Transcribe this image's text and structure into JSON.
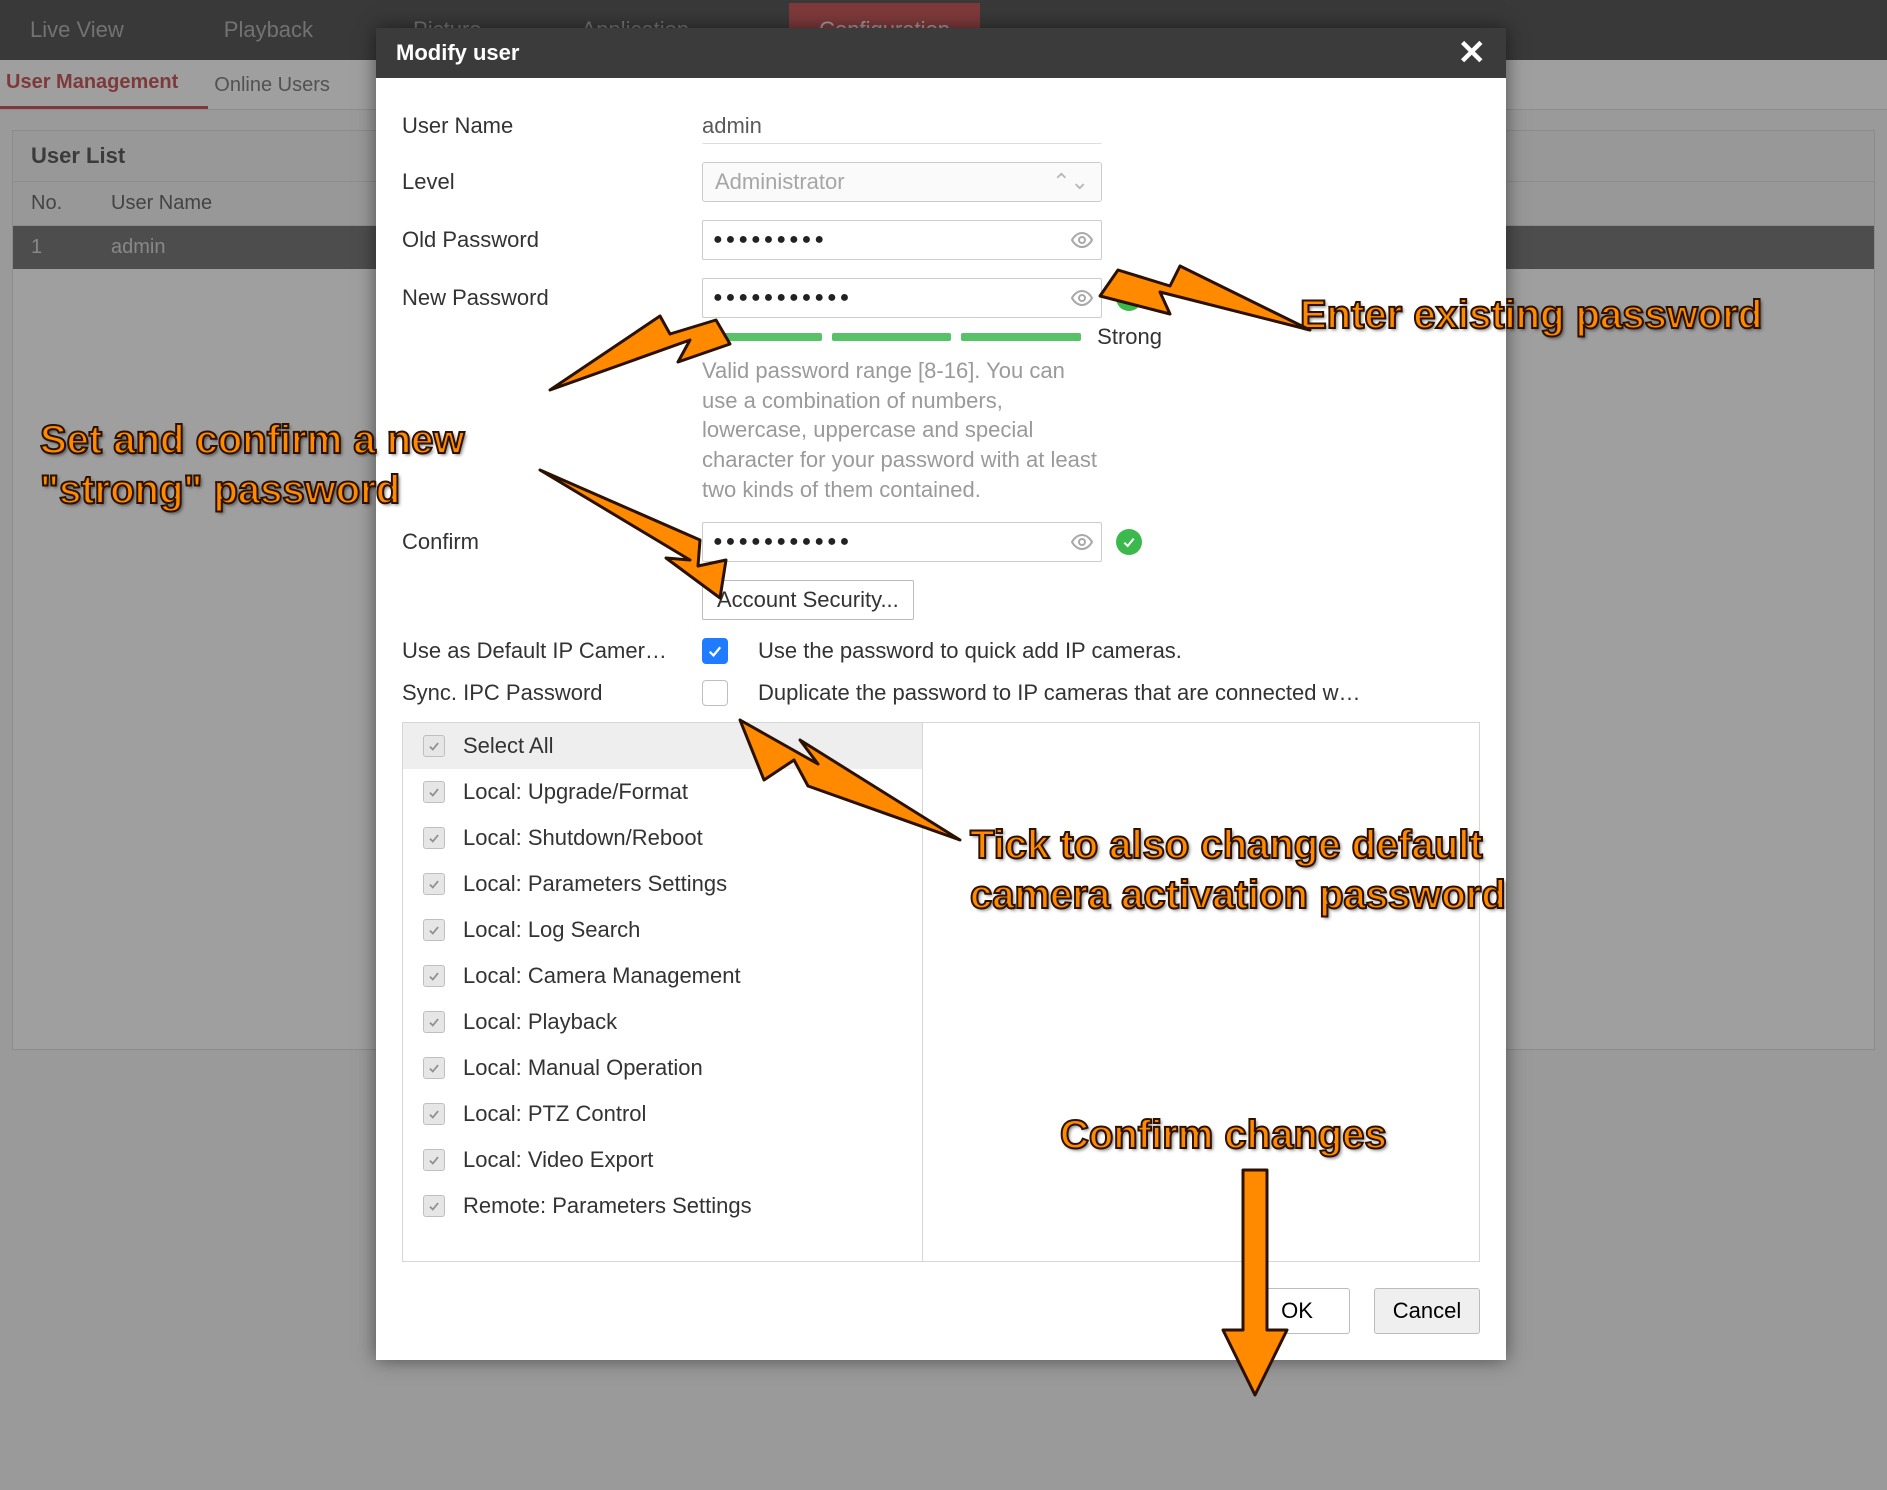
{
  "topnav": {
    "items": [
      "Live View",
      "Playback",
      "Picture",
      "Application",
      "Configuration"
    ],
    "active_index": 4
  },
  "subtabs": {
    "items": [
      "User Management",
      "Online Users"
    ],
    "active_index": 0
  },
  "userlist": {
    "title": "User List",
    "col_no": "No.",
    "col_user": "User Name",
    "rows": [
      {
        "no": "1",
        "user": "admin"
      }
    ]
  },
  "modal": {
    "title": "Modify user",
    "labels": {
      "username": "User Name",
      "level": "Level",
      "old_pw": "Old Password",
      "new_pw": "New Password",
      "confirm": "Confirm",
      "default_cam": "Use as Default IP Camer…",
      "sync_ipc": "Sync. IPC Password"
    },
    "values": {
      "username": "admin",
      "level": "Administrator",
      "old_pw_mask": "●●●●●●●●●",
      "new_pw_mask": "●●●●●●●●●●●",
      "confirm_mask": "●●●●●●●●●●●"
    },
    "strength_label": "Strong",
    "hint": "Valid password range [8-16]. You can use a combination of numbers, lowercase, uppercase and special character for your password with at least two kinds of them contained.",
    "account_security_btn": "Account Security...",
    "default_cam_desc": "Use the password to quick add IP cameras.",
    "default_cam_checked": true,
    "sync_ipc_desc": "Duplicate the password to IP cameras that are connected w…",
    "sync_ipc_checked": false,
    "permissions": {
      "select_all": "Select All",
      "items": [
        "Local: Upgrade/Format",
        "Local: Shutdown/Reboot",
        "Local: Parameters Settings",
        "Local: Log Search",
        "Local: Camera Management",
        "Local: Playback",
        "Local: Manual Operation",
        "Local: PTZ Control",
        "Local: Video Export",
        "Remote: Parameters Settings"
      ]
    },
    "ok": "OK",
    "cancel": "Cancel"
  },
  "annotations": {
    "enter_existing": "Enter existing password",
    "set_confirm": "Set and confirm a new\n\"strong\" password",
    "tick_default": "Tick to also change default\ncamera activation password",
    "confirm_changes": "Confirm changes"
  }
}
